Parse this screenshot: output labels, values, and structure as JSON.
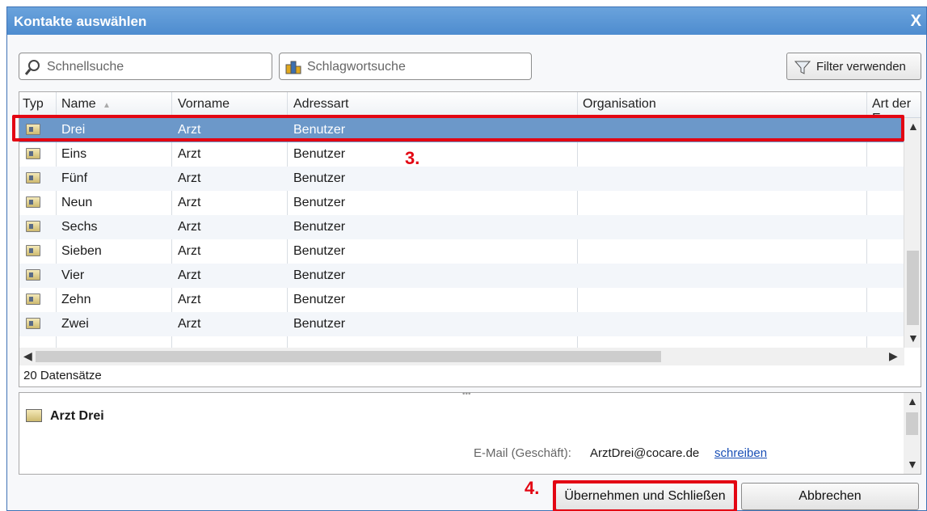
{
  "window": {
    "title": "Kontakte auswählen",
    "close_label": "X"
  },
  "toolbar": {
    "quick_search": "Schnellsuche",
    "tag_search": "Schlagwortsuche",
    "filter_button": "Filter verwenden"
  },
  "table": {
    "columns": [
      "Typ",
      "Name",
      "Vorname",
      "Adressart",
      "Organisation",
      "Art der E"
    ],
    "sort_indicator": "▲",
    "rows": [
      {
        "name": "Drei",
        "vorname": "Arzt",
        "adressart": "Benutzer"
      },
      {
        "name": "Eins",
        "vorname": "Arzt",
        "adressart": "Benutzer"
      },
      {
        "name": "Fünf",
        "vorname": "Arzt",
        "adressart": "Benutzer"
      },
      {
        "name": "Neun",
        "vorname": "Arzt",
        "adressart": "Benutzer"
      },
      {
        "name": "Sechs",
        "vorname": "Arzt",
        "adressart": "Benutzer"
      },
      {
        "name": "Sieben",
        "vorname": "Arzt",
        "adressart": "Benutzer"
      },
      {
        "name": "Vier",
        "vorname": "Arzt",
        "adressart": "Benutzer"
      },
      {
        "name": "Zehn",
        "vorname": "Arzt",
        "adressart": "Benutzer"
      },
      {
        "name": "Zwei",
        "vorname": "Arzt",
        "adressart": "Benutzer"
      }
    ],
    "selected_index": 0,
    "record_count": "20 Datensätze"
  },
  "annotations": {
    "step3": "3.",
    "step4": "4.",
    "color": "#e30613"
  },
  "details": {
    "name": "Arzt Drei",
    "email_label": "E-Mail (Geschäft):",
    "email": "ArztDrei@cocare.de",
    "email_link": "schreiben"
  },
  "buttons": {
    "apply": "Übernehmen und Schließen",
    "cancel": "Abbrechen"
  },
  "icons": {
    "search": "magnifier-icon",
    "tags": "tag-icon",
    "filter": "funnel-icon",
    "contact": "contact-card-icon"
  }
}
